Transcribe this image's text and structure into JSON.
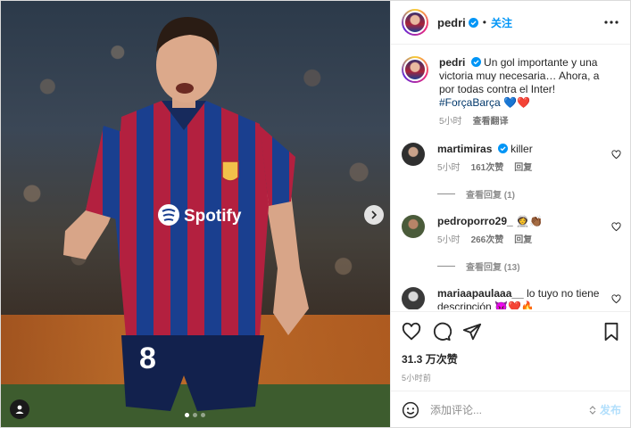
{
  "post": {
    "username": "pedri",
    "follow_label": "关注",
    "separator": "•",
    "more_label": "更多选项"
  },
  "caption": {
    "username": "pedri",
    "text": "Un gol importante y una victoria muy necesaria… Ahora, a por todas contra el Inter!",
    "hashtag": "#ForçaBarça",
    "emojis": "💙❤️",
    "time": "5小时",
    "translate": "查看翻译"
  },
  "comments": [
    {
      "username": "martimiras",
      "text": "killer",
      "time": "5小时",
      "likes": "161次赞",
      "reply": "回复",
      "view_replies": "查看回复 (1)",
      "avatar_color": "#2f2f2f"
    },
    {
      "username": "pedroporro29_",
      "text": "👩‍🚀👏🏾",
      "time": "5小时",
      "likes": "266次赞",
      "reply": "回复",
      "view_replies": "查看回复 (13)",
      "avatar_color": "#4a5b3a"
    },
    {
      "username": "mariaapaulaaa__",
      "text": "lo tuyo no tiene descripción 😈❤️🔥",
      "avatar_color": "#3a3a3a"
    }
  ],
  "stats": {
    "likes": "31.3 万次赞",
    "time": "5小时前"
  },
  "composer": {
    "placeholder": "添加评论...",
    "post_label": "发布"
  },
  "media": {
    "jersey_sponsor": "Spotify",
    "jersey_number": "8",
    "slide_count": 3,
    "active_slide": 1
  },
  "colors": {
    "accent": "#0095f6",
    "post_disabled": "#b2dffc",
    "hashtag": "#00376b",
    "muted": "#8e8e8e"
  },
  "icons": [
    "verified-icon",
    "more-icon",
    "heart-icon",
    "comment-icon",
    "share-icon",
    "bookmark-icon",
    "emoji-icon",
    "next-arrow-icon",
    "user-tag-icon"
  ]
}
